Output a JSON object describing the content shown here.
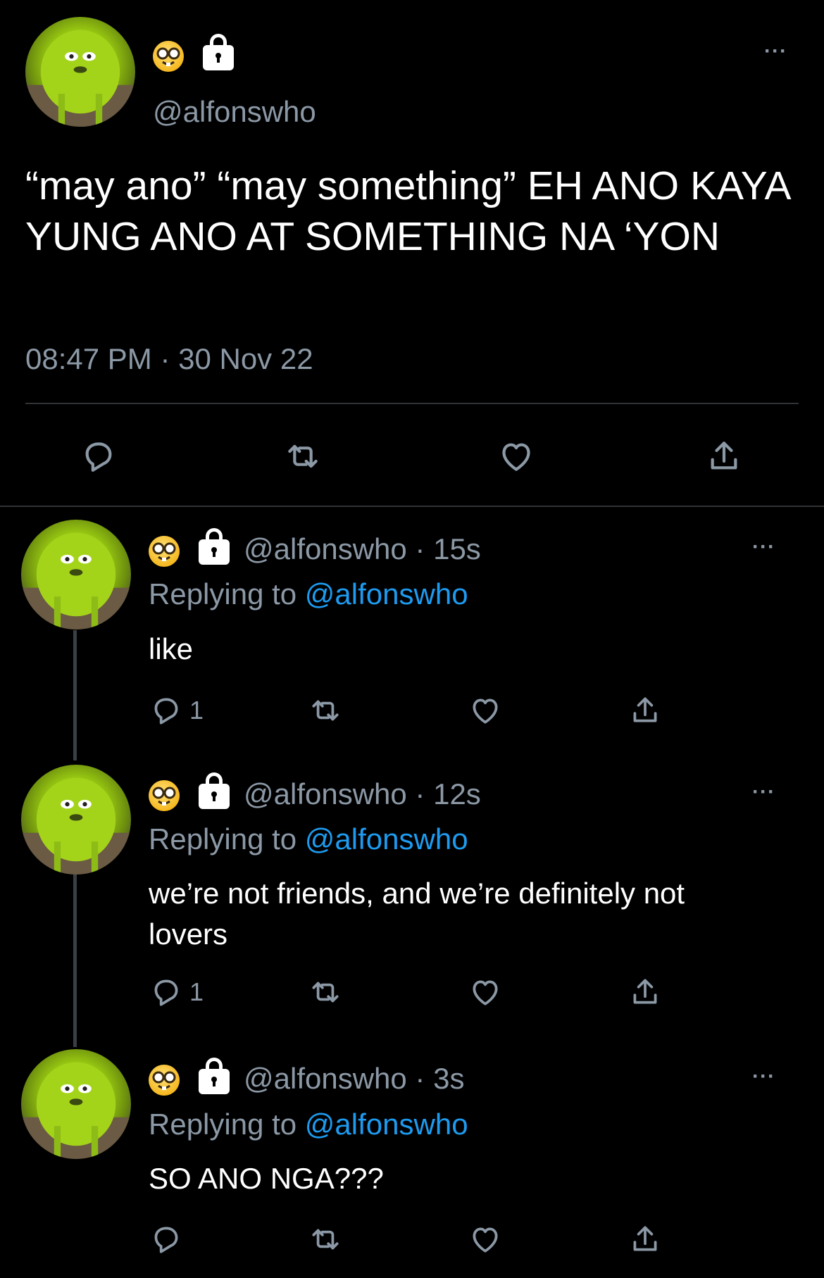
{
  "main_tweet": {
    "handle": "@alfonswho",
    "text": "“may ano” “may something” EH ANO KAYA YUNG ANO AT SOMETHING NA ‘YON",
    "timestamp": "08:47 PM · 30 Nov 22",
    "more_label": "···"
  },
  "replies": [
    {
      "handle": "@alfonswho",
      "time": " · 15s",
      "replying_prefix": "Replying to ",
      "replying_handle": "@alfonswho",
      "text": "like",
      "reply_count": "1"
    },
    {
      "handle": "@alfonswho",
      "time": " · 12s",
      "replying_prefix": "Replying to ",
      "replying_handle": "@alfonswho",
      "text": "we’re not friends, and we’re definitely not lovers",
      "reply_count": "1"
    },
    {
      "handle": "@alfonswho",
      "time": " · 3s",
      "replying_prefix": "Replying to ",
      "replying_handle": "@alfonswho",
      "text": "SO ANO NGA???",
      "reply_count": ""
    }
  ],
  "icons": {
    "reply": "reply-icon",
    "retweet": "retweet-icon",
    "like": "heart-icon",
    "share": "share-icon",
    "nerd": "nerd-face-emoji",
    "lock": "lock-icon",
    "more": "more-icon"
  },
  "colors": {
    "background": "#000000",
    "text": "#e7e9ea",
    "muted": "#8b98a5",
    "link": "#1d9bf0"
  }
}
